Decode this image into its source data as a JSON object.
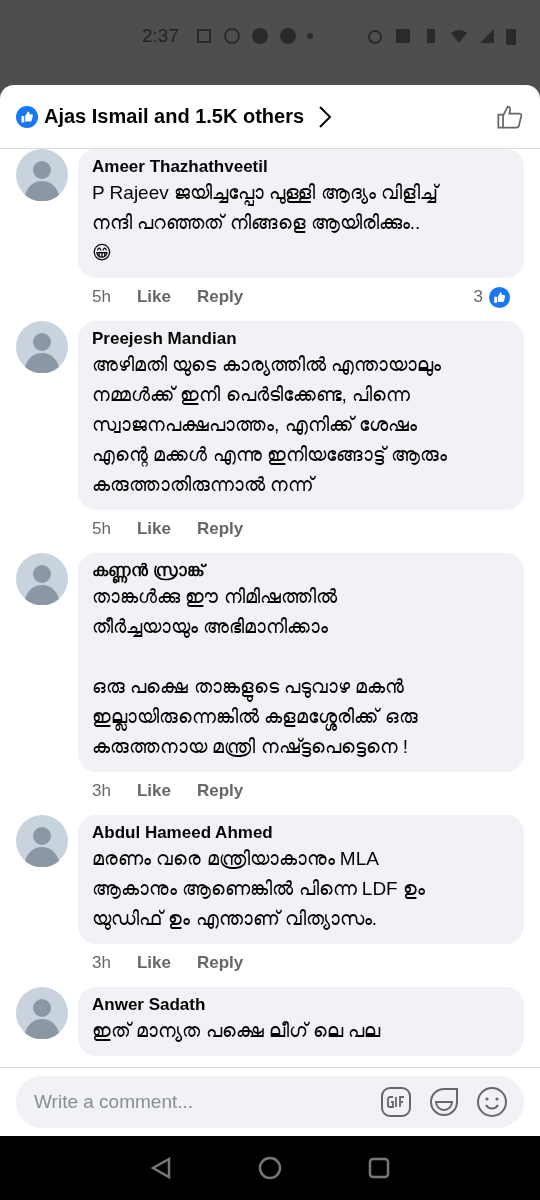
{
  "status_bar": {
    "time": "2:37"
  },
  "reactions_header": {
    "summary": "Ajas Ismail and 1.5K others"
  },
  "comments": [
    {
      "author": "Ameer Thazhathveetil",
      "body": "P Rajeev ജയിച്ചപ്പോ പുള്ളി ആദ്യം വിളിച്ച്\nനന്ദി പറഞ്ഞത് നിങ്ങളെ ആയിരിക്കും..\n😁",
      "time": "5h",
      "like": "Like",
      "reply": "Reply",
      "reaction_count": "3"
    },
    {
      "author": "Preejesh Mandian",
      "body": "അഴിമതി യുടെ കാര്യത്തിൽ എന്തായാലും\nനമ്മൾക്ക് ഇനി പെർടിക്കേണ്ട, പിന്നെ\nസ്വാജനപക്ഷപാത്തം, എനിക്ക് ശേഷം\nഎന്റെ മക്കൾ എന്നു ഇനിയങ്ങോട്ട് ആരും\nകരുത്താതിരുന്നാൽ നന്ന്",
      "time": "5h",
      "like": "Like",
      "reply": "Reply"
    },
    {
      "author": "കണ്ണൻ സ്രാങ്ക്",
      "body": "താങ്കൾക്കു ഈ നിമിഷത്തിൽ\nതീർച്ചയായും അഭിമാനിക്കാം\n\nഒരു പക്ഷെ താങ്കളുടെ പടുവാഴ മകൻ\nഇല്ലായിരുന്നെങ്കിൽ കളമശ്ശേരിക്ക് ഒരു\nകരുത്തനായ മന്ത്രി നഷ്ട്ടപെട്ടെനെ !",
      "time": "3h",
      "like": "Like",
      "reply": "Reply"
    },
    {
      "author": "Abdul Hameed Ahmed",
      "body": "മരണം വരെ മന്ത്രിയാകാനും MLA\nആകാനും ആണെങ്കിൽ പിന്നെ LDF  ഉം\nയുഡിഫ് ഉം എന്താണ് വിത്യാസം.",
      "time": "3h",
      "like": "Like",
      "reply": "Reply"
    },
    {
      "author": "Anwer Sadath",
      "body": "ഇത് മാന്യത പക്ഷെ ലീഗ് ലെ പല"
    }
  ],
  "composer": {
    "placeholder": "Write a comment..."
  }
}
